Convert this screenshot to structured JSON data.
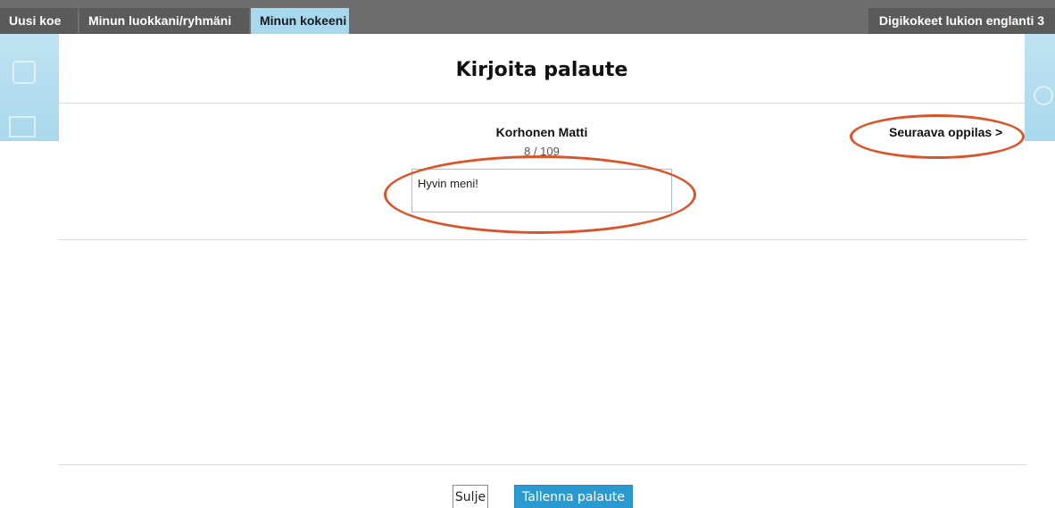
{
  "nav": {
    "tabs": [
      {
        "label": "Uusi koe",
        "active": false
      },
      {
        "label": "Minun luokkani/ryhmäni",
        "active": false
      },
      {
        "label": "Minun kokeeni",
        "active": true
      }
    ],
    "course_title": "Digikokeet lukion englanti 3"
  },
  "modal": {
    "title": "Kirjoita palaute",
    "student_name": "Korhonen Matti",
    "student_count": "8 / 109",
    "next_student_label": "Seuraava oppilas >",
    "feedback_value": "Hyvin meni!",
    "close_label": "Sulje",
    "save_label": "Tallenna palaute"
  },
  "colors": {
    "topbar": "#6d6d6d",
    "active_tab": "#a7d8ee",
    "save_button": "#2b9ad0",
    "annotation": "#d9542a"
  }
}
